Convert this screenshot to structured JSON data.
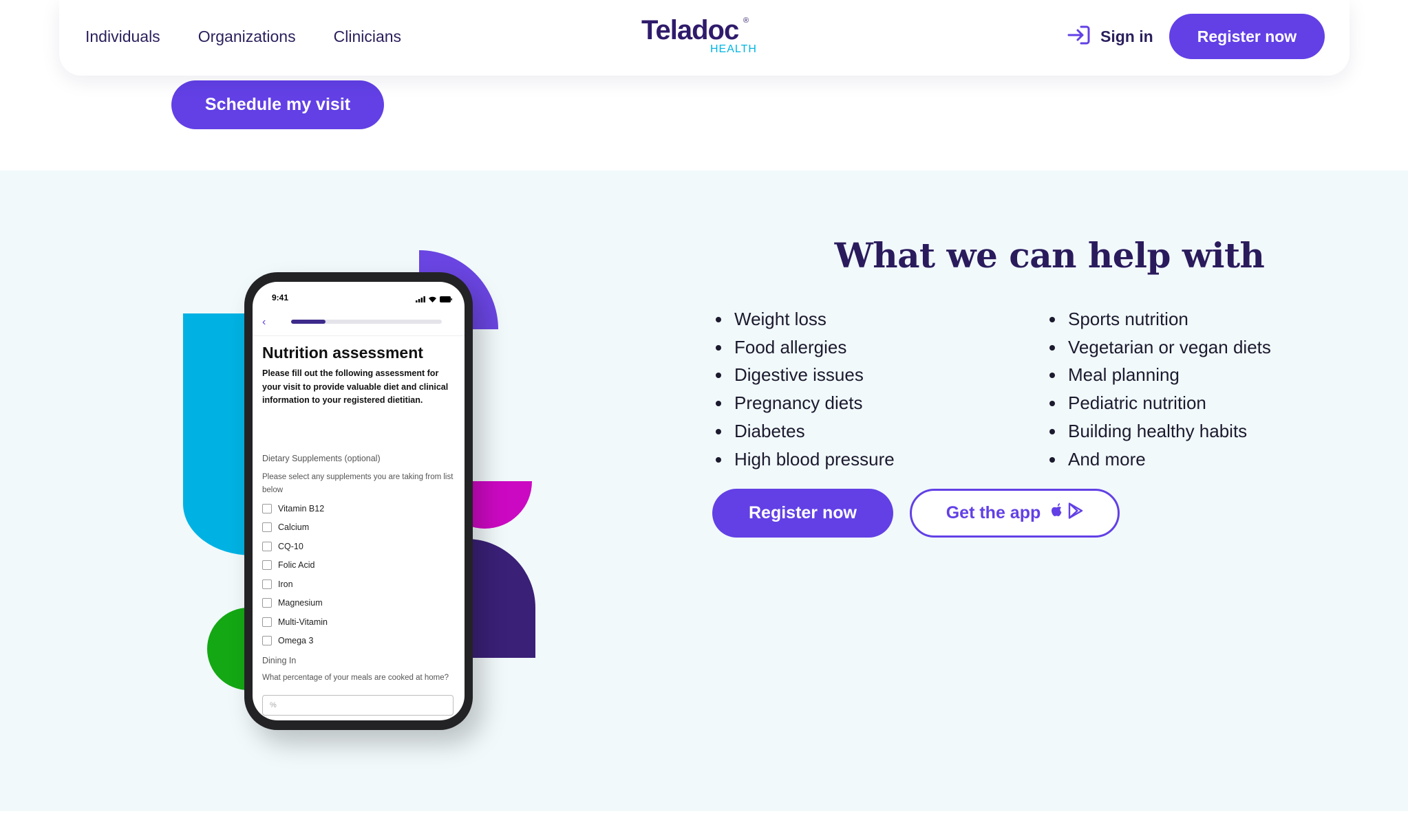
{
  "header": {
    "nav_links": [
      "Individuals",
      "Organizations",
      "Clinicians"
    ],
    "logo": {
      "wordmark": "Teladoc",
      "registered": "®",
      "sub": "HEALTH"
    },
    "signin_label": "Sign in",
    "register_label": "Register now",
    "icons": {
      "signin": "sign-in-arrow-icon"
    }
  },
  "hero": {
    "schedule_label": "Schedule my visit"
  },
  "phone": {
    "time": "9:41",
    "progress_fraction": 0.23,
    "title": "Nutrition assessment",
    "description": "Please fill out the following assessment for your visit to provide valuable diet and clinical information to your registered dietitian.",
    "supplements_label": "Dietary Supplements (optional)",
    "supplements_help": "Please select any supplements you are taking from list below",
    "supplements": [
      "Vitamin B12",
      "Calcium",
      "CQ-10",
      "Folic Acid",
      "Iron",
      "Magnesium",
      "Multi-Vitamin",
      "Omega 3"
    ],
    "dining_label": "Dining In",
    "dining_help": "What percentage of your meals are cooked at home?",
    "dining_placeholder": "%"
  },
  "help": {
    "heading": "What we can help with",
    "left_items": [
      "Weight loss",
      "Food allergies",
      "Digestive issues",
      "Pregnancy diets",
      "Diabetes",
      "High blood pressure"
    ],
    "right_items": [
      "Sports nutrition",
      "Vegetarian or vegan diets",
      "Meal planning",
      "Pediatric nutrition",
      "Building healthy habits",
      "And more"
    ],
    "register_label": "Register now",
    "app_label": "Get the app",
    "app_icons": [
      "apple-icon",
      "google-play-icon"
    ]
  },
  "colors": {
    "brand_purple": "#6240e5",
    "dark_indigo": "#2a1b5c",
    "cyan": "#00b2e3",
    "magenta": "#cc09c2",
    "green": "#14a814",
    "section_bg": "#f1f9fb"
  }
}
